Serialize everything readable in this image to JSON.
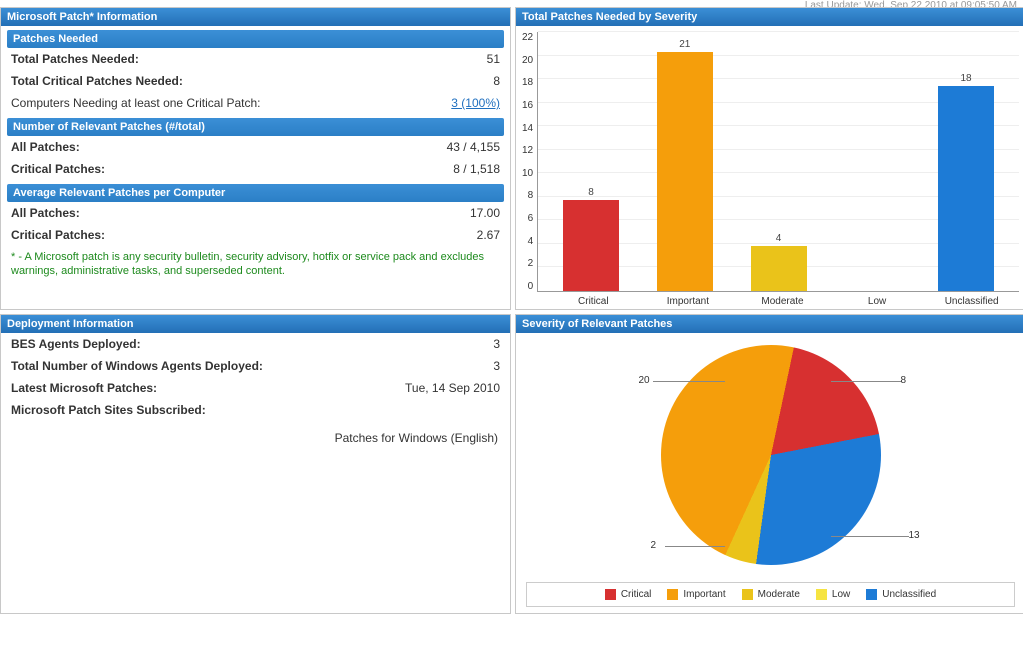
{
  "meta": {
    "last_update": "Last Update: Wed, Sep 22 2010 at 09:05:50 AM"
  },
  "patch_info": {
    "title": "Microsoft Patch* Information",
    "sections": {
      "needed": {
        "title": "Patches Needed",
        "rows": {
          "total": {
            "label": "Total Patches Needed:",
            "value": "51"
          },
          "critical": {
            "label": "Total Critical Patches Needed:",
            "value": "8"
          },
          "computers": {
            "label": "Computers Needing at least one Critical Patch:",
            "value": "3 (100%)"
          }
        }
      },
      "relevant": {
        "title": "Number of Relevant Patches (#/total)",
        "rows": {
          "all": {
            "label": "All Patches:",
            "value": "43 / 4,155"
          },
          "critical": {
            "label": "Critical Patches:",
            "value": "8 / 1,518"
          }
        }
      },
      "avg": {
        "title": "Average Relevant Patches per Computer",
        "rows": {
          "all": {
            "label": "All Patches:",
            "value": "17.00"
          },
          "critical": {
            "label": "Critical Patches:",
            "value": "2.67"
          }
        }
      }
    },
    "footnote": "* - A Microsoft patch is any security bulletin, security advisory, hotfix or service pack and excludes warnings, administrative tasks, and superseded content."
  },
  "deployment": {
    "title": "Deployment Information",
    "rows": {
      "bes": {
        "label": "BES Agents Deployed:",
        "value": "3"
      },
      "win": {
        "label": "Total Number of Windows Agents Deployed:",
        "value": "3"
      },
      "latest": {
        "label": "Latest Microsoft Patches:",
        "value": "Tue, 14 Sep 2010"
      },
      "sites": {
        "label": "Microsoft Patch Sites Subscribed:",
        "value": ""
      }
    },
    "sites_list": "Patches for Windows (English)"
  },
  "bar_chart": {
    "title": "Total Patches Needed by Severity"
  },
  "pie_chart": {
    "title": "Severity of Relevant Patches"
  },
  "legend": {
    "critical": "Critical",
    "important": "Important",
    "moderate": "Moderate",
    "low": "Low",
    "unclassified": "Unclassified"
  },
  "colors": {
    "critical": "#d73030",
    "important": "#f59e0b",
    "moderate": "#eac31a",
    "low": "#f6e441",
    "unclassified": "#1d7bd6"
  },
  "chart_data": [
    {
      "type": "bar",
      "title": "Total Patches Needed by Severity",
      "categories": [
        "Critical",
        "Important",
        "Moderate",
        "Low",
        "Unclassified"
      ],
      "values": [
        8,
        21,
        4,
        0,
        18
      ],
      "ylabel": "",
      "xlabel": "",
      "ylim": [
        0,
        22
      ],
      "yticks": [
        0,
        2,
        4,
        6,
        8,
        10,
        12,
        14,
        16,
        18,
        20,
        22
      ]
    },
    {
      "type": "pie",
      "title": "Severity of Relevant Patches",
      "series": [
        {
          "name": "Critical",
          "value": 8
        },
        {
          "name": "Important",
          "value": 20
        },
        {
          "name": "Moderate",
          "value": 2
        },
        {
          "name": "Low",
          "value": 0
        },
        {
          "name": "Unclassified",
          "value": 13
        }
      ]
    }
  ]
}
